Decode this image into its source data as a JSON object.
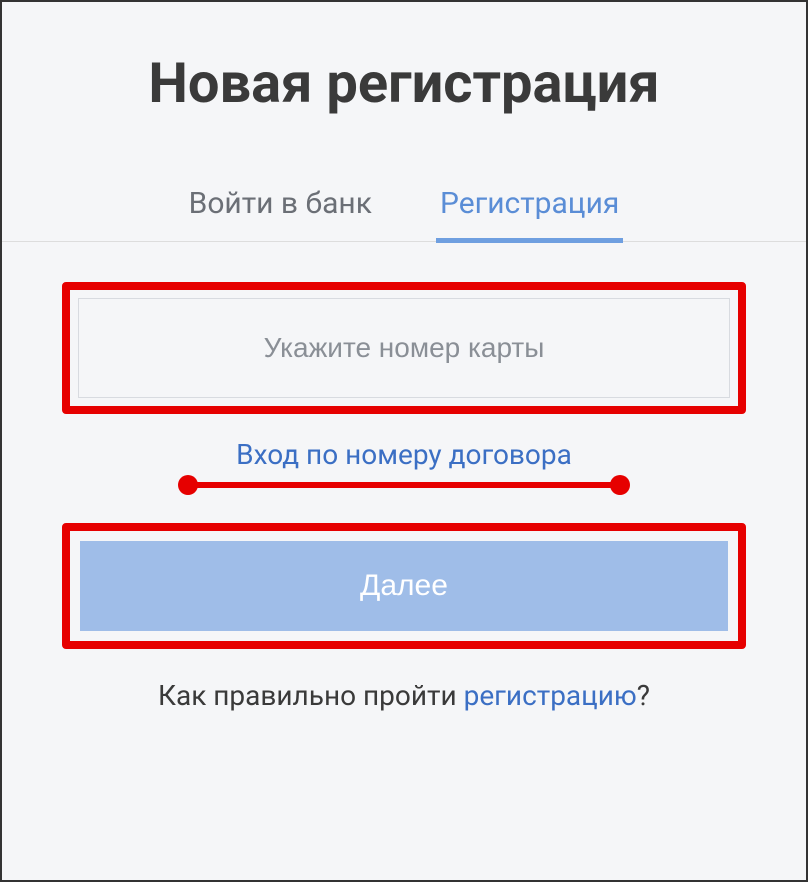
{
  "title": "Новая регистрация",
  "tabs": {
    "login": "Войти в банк",
    "register": "Регистрация"
  },
  "form": {
    "card_placeholder": "Укажите номер карты",
    "contract_link": "Вход по номеру договора",
    "next_button": "Далее"
  },
  "help": {
    "prefix": "Как правильно пройти ",
    "link": "регистрацию",
    "suffix": "?"
  }
}
